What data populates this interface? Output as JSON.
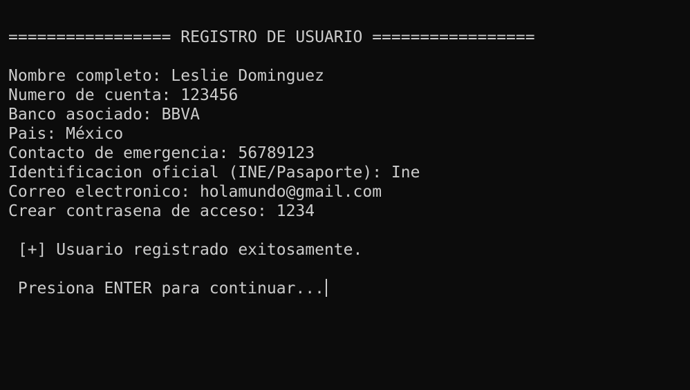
{
  "terminal": {
    "header": "================= REGISTRO DE USUARIO =================",
    "fields": [
      {
        "label": "Nombre completo: ",
        "value": "Leslie Dominguez"
      },
      {
        "label": "Numero de cuenta: ",
        "value": "123456"
      },
      {
        "label": "Banco asociado: ",
        "value": "BBVA"
      },
      {
        "label": "Pais: ",
        "value": "México"
      },
      {
        "label": "Contacto de emergencia: ",
        "value": "56789123"
      },
      {
        "label": "Identificacion oficial (INE/Pasaporte): ",
        "value": "Ine"
      },
      {
        "label": "Correo electronico: ",
        "value": "holamundo@gmail.com"
      },
      {
        "label": "Crear contrasena de acceso: ",
        "value": "1234"
      }
    ],
    "success_message": " [+] Usuario registrado exitosamente.",
    "prompt": " Presiona ENTER para continuar..."
  },
  "colors": {
    "background": "#0c0c0c",
    "text": "#cccccc"
  }
}
